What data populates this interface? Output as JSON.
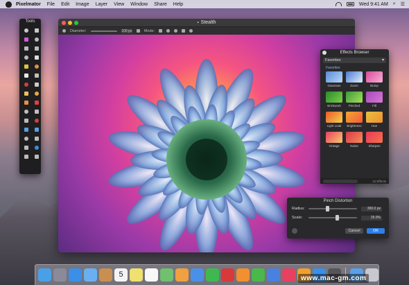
{
  "menubar": {
    "app_name": "Pixelmator",
    "items": [
      "File",
      "Edit",
      "Image",
      "Layer",
      "View",
      "Window",
      "Share",
      "Help"
    ],
    "clock": "Wed 9:41 AM"
  },
  "window": {
    "title": "Stealth",
    "toolbar": {
      "diameter_label": "Diameter:",
      "diameter_value": "100 px",
      "mode_label": "Mode:"
    }
  },
  "tools": {
    "title": "Tools",
    "items": [
      {
        "icon": "move-icon",
        "color": "#c8c8c8"
      },
      {
        "icon": "arrange-icon",
        "color": "#c8c8c8"
      },
      {
        "icon": "brush-icon",
        "color": "#d45ad8"
      },
      {
        "icon": "lasso-icon",
        "color": "#bbbbbb"
      },
      {
        "icon": "rect-select-icon",
        "color": "#bbbbbb"
      },
      {
        "icon": "ellipse-select-icon",
        "color": "#bbbbbb"
      },
      {
        "icon": "crop-icon",
        "color": "#bbbbbb"
      },
      {
        "icon": "eyedropper-icon",
        "color": "#dddddd"
      },
      {
        "icon": "magic-wand-icon",
        "color": "#e0c040"
      },
      {
        "icon": "pencil-icon",
        "color": "#e09040"
      },
      {
        "icon": "eraser-icon",
        "color": "#e8e8e8"
      },
      {
        "icon": "paint-bucket-icon",
        "color": "#c0c0c0"
      },
      {
        "icon": "gradient-icon",
        "color": "#d04040"
      },
      {
        "icon": "clone-icon",
        "color": "#cccccc"
      },
      {
        "icon": "heal-icon",
        "color": "#e8c060"
      },
      {
        "icon": "light-icon",
        "color": "#e8a840"
      },
      {
        "icon": "sponge-icon",
        "color": "#e89040"
      },
      {
        "icon": "burn-icon",
        "color": "#e04040"
      },
      {
        "icon": "smudge-icon",
        "color": "#c0c0c0"
      },
      {
        "icon": "sharpen-icon",
        "color": "#c0c0c0"
      },
      {
        "icon": "eye-icon",
        "color": "#bbbbbb"
      },
      {
        "icon": "red-eye-icon",
        "color": "#d04040"
      },
      {
        "icon": "blur-icon",
        "color": "#5aa0e0"
      },
      {
        "icon": "warp-icon",
        "color": "#5aa0e0"
      },
      {
        "icon": "pen-icon",
        "color": "#bbbbbb"
      },
      {
        "icon": "freeform-pen-icon",
        "color": "#bbbbbb"
      },
      {
        "icon": "shape-icon",
        "color": "#bbbbbb"
      },
      {
        "icon": "heart-shape-icon",
        "color": "#3a8ee0"
      },
      {
        "icon": "zoom-icon",
        "color": "#bbbbbb"
      },
      {
        "icon": "hand-icon",
        "color": "#bbbbbb"
      }
    ]
  },
  "effects_browser": {
    "title": "Effects Browser",
    "category": "Favorites",
    "section_label": "Favorites",
    "effects": [
      {
        "label": "Gaussian",
        "color1": "#5a8ad8",
        "color2": "#b8d8f8"
      },
      {
        "label": "Zoom",
        "color1": "#4a7ad0",
        "color2": "#e0f0ff"
      },
      {
        "label": "Bump",
        "color1": "#d84a9a",
        "color2": "#f8b0d8"
      },
      {
        "label": "Brickwork",
        "color1": "#2a8a2a",
        "color2": "#7ad04a"
      },
      {
        "label": "Pinched",
        "color1": "#3a9a3a",
        "color2": "#a8e05a"
      },
      {
        "label": "Fill",
        "color1": "#a848b8",
        "color2": "#d878d8"
      },
      {
        "label": "Light Leak",
        "color1": "#e85a2a",
        "color2": "#f8d04a"
      },
      {
        "label": "Brightness",
        "color1": "#f0a830",
        "color2": "#f85a3a"
      },
      {
        "label": "Hue",
        "color1": "#e8c040",
        "color2": "#f09030"
      },
      {
        "label": "Vintage",
        "color1": "#e84060",
        "color2": "#f8c870"
      },
      {
        "label": "Noise",
        "color1": "#d83a4a",
        "color2": "#f88a5a"
      },
      {
        "label": "Sharpen",
        "color1": "#e83a5a",
        "color2": "#f8704a"
      }
    ],
    "count": "12 Effects"
  },
  "pinch_panel": {
    "title": "Pinch Distortion",
    "radius_label": "Radius:",
    "radius_value": "300.0 px",
    "radius_fraction": 0.38,
    "scale_label": "Scale:",
    "scale_value": "25.0%",
    "scale_fraction": 0.6,
    "cancel_label": "Cancel",
    "ok_label": "OK"
  },
  "dock": {
    "apps": [
      {
        "name": "finder-icon",
        "color": "#4aa0e8"
      },
      {
        "name": "launchpad-icon",
        "color": "#8a8a9a"
      },
      {
        "name": "safari-icon",
        "color": "#3a90e8"
      },
      {
        "name": "mail-icon",
        "color": "#6ab0f0"
      },
      {
        "name": "contacts-icon",
        "color": "#c89050"
      },
      {
        "name": "calendar-icon",
        "color": "#f4f4f4"
      },
      {
        "name": "notes-icon",
        "color": "#f0e070"
      },
      {
        "name": "reminders-icon",
        "color": "#f8f8f8"
      },
      {
        "name": "maps-icon",
        "color": "#70c070"
      },
      {
        "name": "photos-icon",
        "color": "#f0a040"
      },
      {
        "name": "messages-icon",
        "color": "#4a90e8"
      },
      {
        "name": "facetime-icon",
        "color": "#40b850"
      },
      {
        "name": "photo-booth-icon",
        "color": "#d83a3a"
      },
      {
        "name": "pages-icon",
        "color": "#f09030"
      },
      {
        "name": "numbers-icon",
        "color": "#4ab84a"
      },
      {
        "name": "keynote-icon",
        "color": "#4a80e0"
      },
      {
        "name": "itunes-icon",
        "color": "#e84060"
      },
      {
        "name": "ibooks-icon",
        "color": "#f0a030"
      },
      {
        "name": "app-store-icon",
        "color": "#3a90e8"
      },
      {
        "name": "pixelmator-icon",
        "color": "#555558"
      },
      {
        "name": "downloads-icon",
        "color": "#5aa0e8"
      },
      {
        "name": "trash-icon",
        "color": "#c8c8d0"
      }
    ],
    "calendar_day": "5"
  },
  "watermark": "www.mac-gm.com"
}
